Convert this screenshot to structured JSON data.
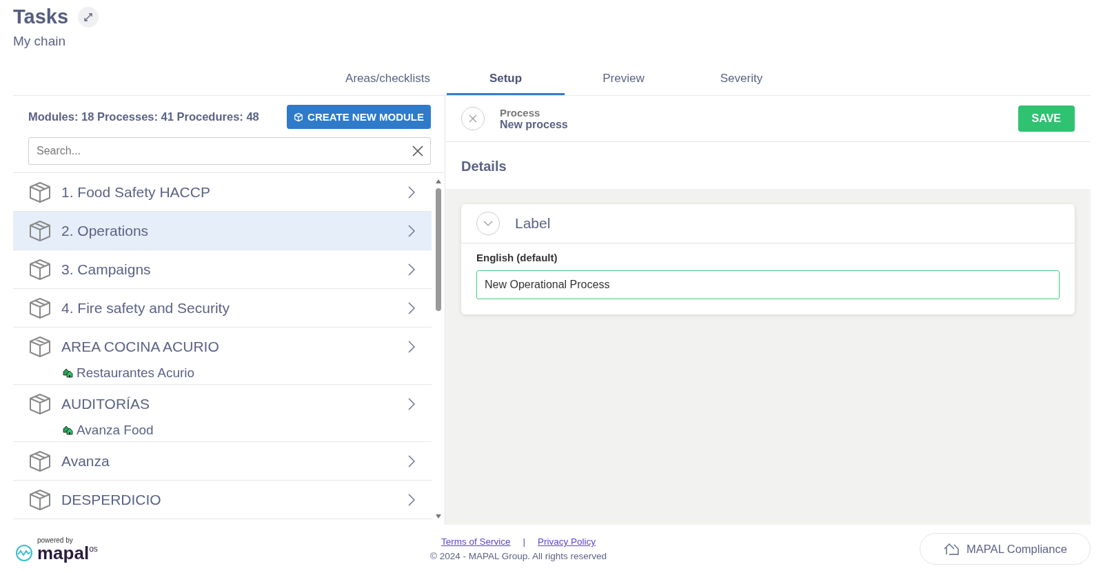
{
  "header": {
    "title": "Tasks",
    "subtitle": "My chain"
  },
  "tabs": [
    {
      "label": "Areas/checklists",
      "selected": false
    },
    {
      "label": "Setup",
      "selected": true
    },
    {
      "label": "Preview",
      "selected": false
    },
    {
      "label": "Severity",
      "selected": false
    }
  ],
  "left": {
    "counts": "Modules: 18 Processes: 41 Procedures: 48",
    "create_button": "CREATE NEW MODULE",
    "search": {
      "placeholder": "Search..."
    },
    "modules": [
      {
        "name": "1. Food Safety HACCP",
        "selected": false
      },
      {
        "name": "2. Operations",
        "selected": true
      },
      {
        "name": "3. Campaigns",
        "selected": false
      },
      {
        "name": "4. Fire safety and Security",
        "selected": false
      },
      {
        "name": "AREA COCINA ACURIO",
        "selected": false,
        "location": "Restaurantes Acurio"
      },
      {
        "name": "AUDITORÍAS",
        "selected": false,
        "location": "Avanza Food"
      },
      {
        "name": "Avanza",
        "selected": false
      },
      {
        "name": "DESPERDICIO",
        "selected": false
      }
    ]
  },
  "right": {
    "type": "Process",
    "name": "New process",
    "save_button": "SAVE",
    "section": "Details",
    "card": {
      "title": "Label",
      "field_label": "English (default)",
      "value": "New Operational Process"
    }
  },
  "footer": {
    "powered_by": "powered by",
    "logo": "mapal",
    "logo_suffix": "os",
    "links": [
      "Terms of Service",
      "Privacy Policy"
    ],
    "separator": "|",
    "copyright": "© 2024 - MAPAL Group. All rights reserved",
    "app_button": "MAPAL Compliance"
  }
}
